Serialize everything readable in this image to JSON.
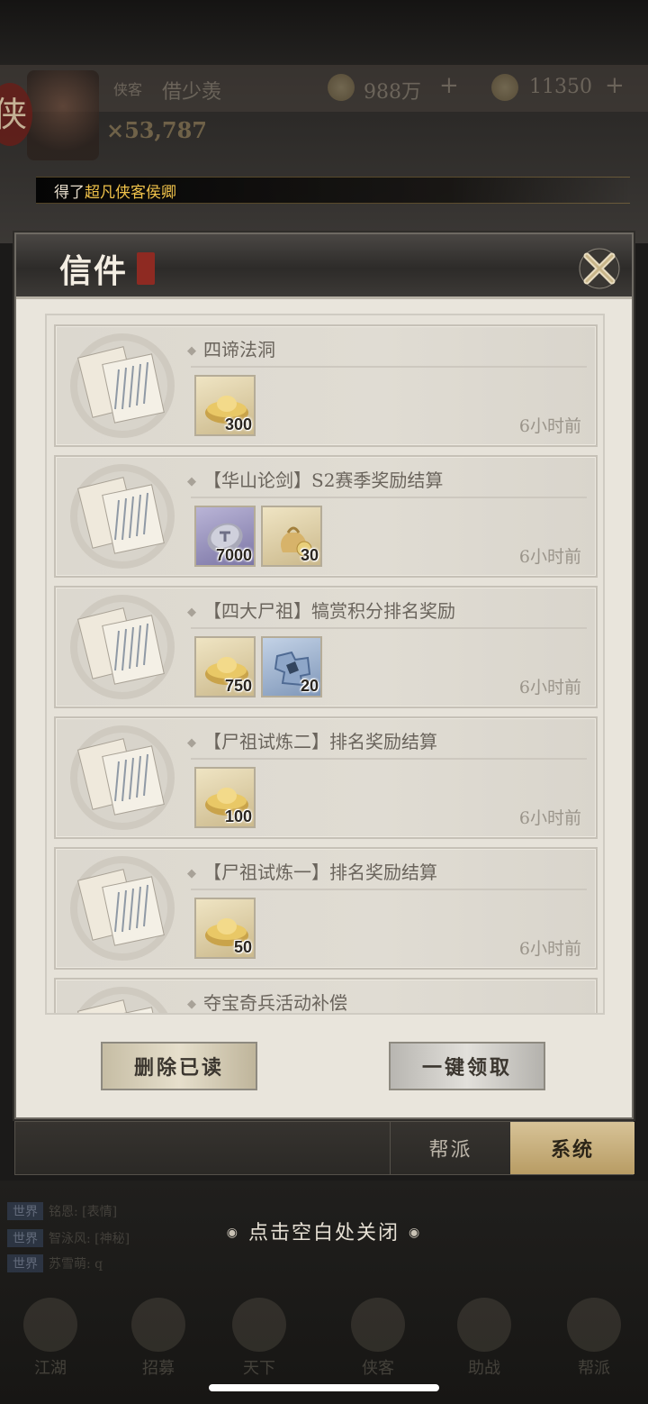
{
  "background": {
    "player_tag": "侠客",
    "player_name": "借少羡",
    "currency_1": "988万",
    "currency_2": "11350",
    "power": "×53,787",
    "seal_char": "侠",
    "notice_prefix": "得了",
    "notice_highlight": "超凡侠客侯卿",
    "chat": [
      {
        "tag": "世界",
        "text": "铭恩: [表情]"
      },
      {
        "tag": "世界",
        "text": "智泳风: [神秘]"
      },
      {
        "tag": "世界",
        "text": "苏雪萌: q"
      }
    ],
    "nav": [
      "江湖",
      "招募",
      "天下",
      "侠客",
      "助战",
      "帮派"
    ]
  },
  "dialog": {
    "title": "信件",
    "mails": [
      {
        "title": "四谛法洞",
        "time": "6小时前",
        "rewards": [
          {
            "type": "gold",
            "icon": "gold-ingot-icon",
            "count": "300"
          }
        ]
      },
      {
        "title": "【华山论剑】S2赛季奖励结算",
        "time": "6小时前",
        "rewards": [
          {
            "type": "purple",
            "icon": "silver-token-icon",
            "count": "7000"
          },
          {
            "type": "gold",
            "icon": "money-bag-icon",
            "count": "30"
          }
        ]
      },
      {
        "title": "【四大尸祖】犒赏积分排名奖励",
        "time": "6小时前",
        "rewards": [
          {
            "type": "gold",
            "icon": "gold-ingot-icon",
            "count": "750"
          },
          {
            "type": "blue",
            "icon": "puzzle-fragment-icon",
            "count": "20"
          }
        ]
      },
      {
        "title": "【尸祖试炼二】排名奖励结算",
        "time": "6小时前",
        "rewards": [
          {
            "type": "gold",
            "icon": "gold-ingot-icon",
            "count": "100"
          }
        ]
      },
      {
        "title": "【尸祖试炼一】排名奖励结算",
        "time": "6小时前",
        "rewards": [
          {
            "type": "gold",
            "icon": "gold-ingot-icon",
            "count": "50"
          }
        ]
      },
      {
        "title": "夺宝奇兵活动补偿",
        "time": "",
        "rewards": []
      }
    ],
    "delete_read_label": "删除已读",
    "claim_all_label": "一键领取"
  },
  "tabs": {
    "guild_label": "帮派",
    "system_label": "系统"
  },
  "close_hint": "点击空白处关闭"
}
